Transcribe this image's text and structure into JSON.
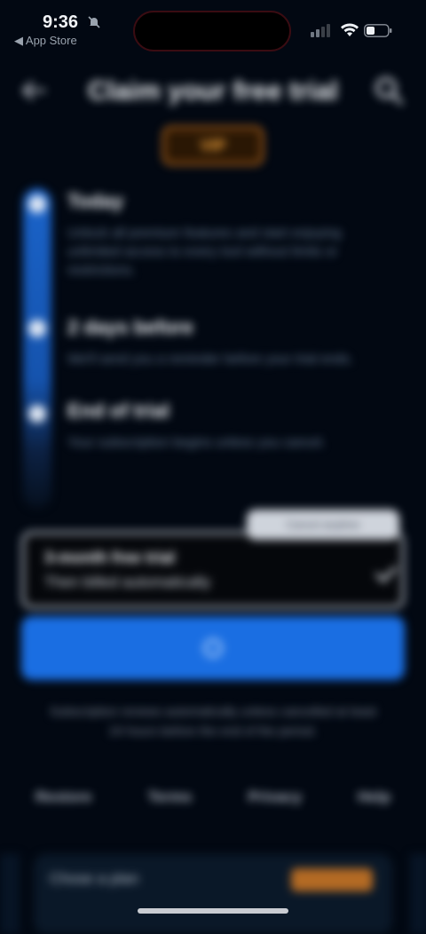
{
  "status_bar": {
    "time": "9:36",
    "back_app": "◀ App Store"
  },
  "header": {
    "title": "Claim your free trial"
  },
  "badge": {
    "label": "VIP"
  },
  "timeline": {
    "steps": [
      {
        "title": "Today",
        "description": "Unlock all premium features and start enjoying unlimited access to every tool without limits or restrictions."
      },
      {
        "title": "2 days before",
        "description": "We'll send you a reminder before your trial ends."
      },
      {
        "title": "End of trial",
        "description": "Your subscription begins unless you cancel."
      }
    ]
  },
  "trial_option": {
    "tooltip": "Cancel anytime",
    "title": "3-month free trial",
    "subtitle": "Then billed automatically"
  },
  "legal_text": "Subscription renews automatically unless cancelled at least 24 hours before the end of the period.",
  "footer_links": [
    "Restore",
    "Terms",
    "Privacy",
    "Help"
  ],
  "plan_panel": {
    "label": "Chose a plan"
  },
  "colors": {
    "accent": "#1a6ee2",
    "badge": "#c9711c",
    "background": "#020812"
  }
}
